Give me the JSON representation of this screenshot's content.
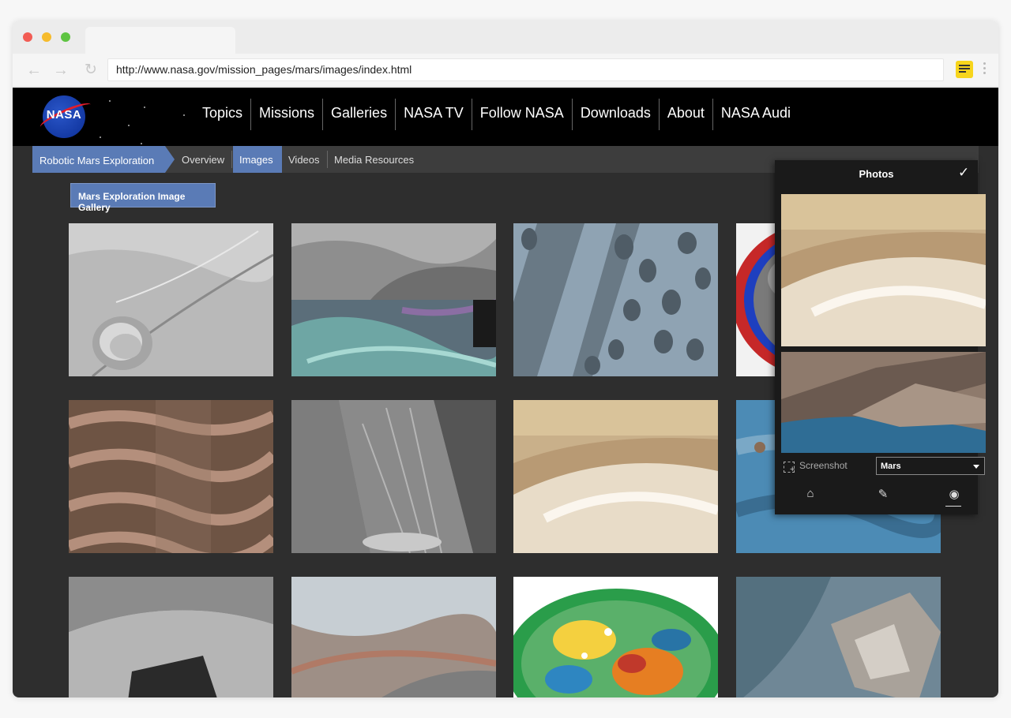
{
  "browser": {
    "url": "http://www.nasa.gov/mission_pages/mars/images/index.html",
    "icons": [
      "back-arrow-icon",
      "forward-arrow-icon",
      "reload-icon",
      "notes-extension-icon",
      "kebab-menu-icon"
    ]
  },
  "site": {
    "logo_text": "NASA",
    "nav": [
      "Topics",
      "Missions",
      "Galleries",
      "NASA TV",
      "Follow NASA",
      "Downloads",
      "About",
      "NASA Audi"
    ],
    "breadcrumb": "Robotic Mars Exploration",
    "subnav": [
      "Overview",
      "Images",
      "Videos",
      "Media Resources"
    ],
    "active_subnav": "Images",
    "gallery_button": "Mars Exploration Image Gallery"
  },
  "panel": {
    "title": "Photos",
    "screenshot_label": "Screenshot",
    "album_select": "Mars",
    "tabs": [
      "home-icon",
      "edit-icon",
      "camera-icon"
    ],
    "active_tab": "camera-icon"
  },
  "colors": {
    "accent": "#5a7bb6",
    "page_bg": "#2e2e2e",
    "header_bg": "#000000",
    "panel_bg": "#1a1a1a",
    "extension_yellow": "#f7d51c"
  }
}
